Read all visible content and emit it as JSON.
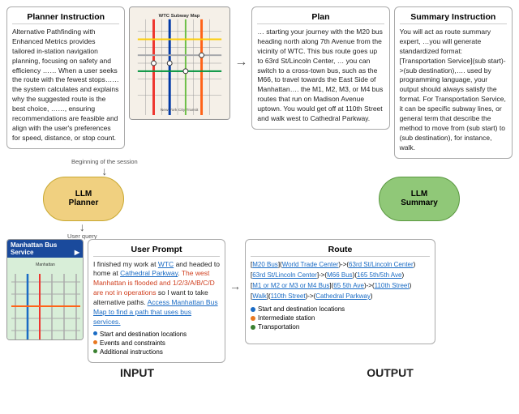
{
  "header": {
    "planner_instruction_title": "Planner Instruction",
    "summary_instruction_title": "Summary Instruction",
    "plan_title": "Plan",
    "summary_title": "Summary"
  },
  "planner_instruction": {
    "text": "Alternative Pathfinding with Enhanced Metrics provides tailored in-station navigation planning, focusing on safety and efficiency …… When a user seeks the route with the fewest stops…… the system calculates and explains why the suggested route is the best choice, ……, ensuring recommendations are feasible and align with the user's preferences for speed, distance, or stop count."
  },
  "plan": {
    "text": "… starting your journey with the M20 bus heading north along 7th Avenue from the vicinity of WTC. This bus route goes up to 63rd St/Lincoln Center, … you can switch to a cross-town bus, such as the M66, to travel towards the East Side of Manhattan…. the M1, M2, M3, or M4 bus routes that run on Madison Avenue uptown. You would get off at 110th Street and walk west to Cathedral Parkway."
  },
  "summary_instruction": {
    "text": "You will act as route summary expert, …you will generate standardized format: [Transportation Service](sub start)->(sub destination),…. used by programming language, your output should always satisfy the format. For Transportation Service, it can be specific subway lines, or general term that describe the method to move from (sub start) to (sub destination), for instance, walk."
  },
  "llm_planner": {
    "label": "LLM\nPlanner"
  },
  "llm_summary": {
    "label": "LLM\nSummary"
  },
  "session_label": "Beginning of the session",
  "user_query_label": "User query",
  "user_prompt": {
    "title": "User Prompt",
    "text_parts": [
      "I finished my work at ",
      "WTC",
      " and headed to home at ",
      "Cathedral Parkway",
      ". The west Manhattan is flooded and 1/2/3/A/B/C/D are not in operations so I want to take alternative paths. Access Manhattan Bus Map to find a path that uses bus services."
    ],
    "bullets": [
      {
        "color": "blue",
        "text": "Start and destination locations"
      },
      {
        "color": "orange",
        "text": "Events and constraints"
      },
      {
        "color": "green",
        "text": "Additional instructions"
      }
    ]
  },
  "route": {
    "title": "Route",
    "entries": [
      "[M20 Bus](World Trade Center)->(63rd St/Lincoln Center)",
      "[63rd St/Lincoln Center]->(M66 Bus)(165 5th/5th Ave)",
      "[M1 or M2 or M3 or M4 Bus](65 5th Ave)->(110th Street)",
      "[Walk](110th Street)->(Cathedral Parkway)"
    ],
    "legend": [
      {
        "color": "#1a6bc4",
        "text": "Start and destination locations"
      },
      {
        "color": "#e87820",
        "text": "Intermediate station"
      },
      {
        "color": "#3a8030",
        "text": "Transportation"
      }
    ]
  },
  "manhattan_bus": {
    "header": "Manhattan Bus Service"
  },
  "io_labels": {
    "input": "INPUT",
    "output": "OUTPUT"
  },
  "wtc_map": {
    "title": "WTC Subway Map"
  }
}
